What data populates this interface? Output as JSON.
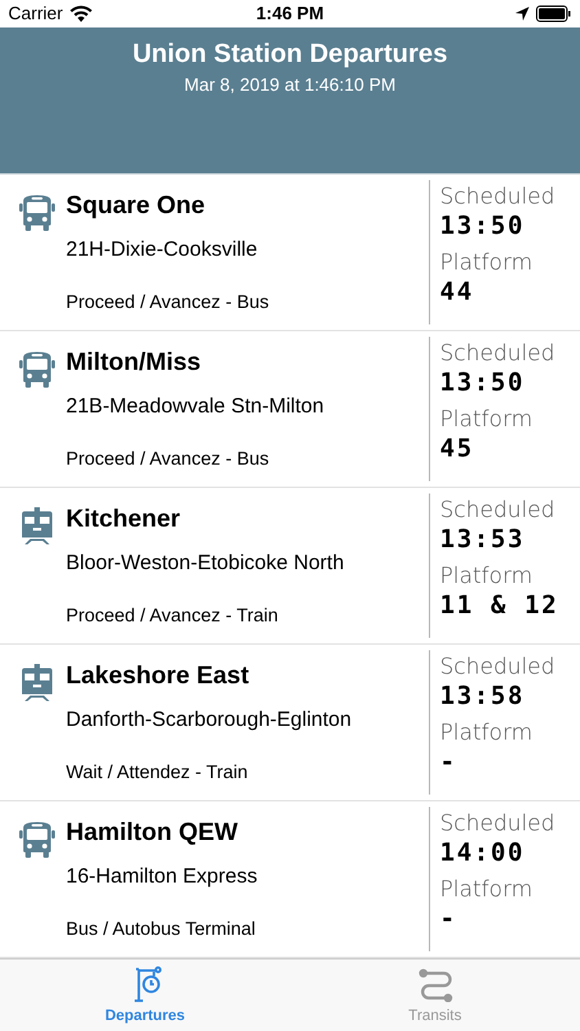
{
  "status_bar": {
    "carrier": "Carrier",
    "time": "1:46 PM"
  },
  "header": {
    "title": "Union Station Departures",
    "subtitle": "Mar 8, 2019 at 1:46:10 PM"
  },
  "departures": [
    {
      "kind": "bus",
      "destination": "Square One",
      "route": "21H-Dixie-Cooksville",
      "status": "Proceed / Avancez - Bus",
      "scheduled_label": "Scheduled",
      "scheduled": "13:50",
      "platform_label": "Platform",
      "platform": "44"
    },
    {
      "kind": "bus",
      "destination": "Milton/Miss",
      "route": "21B-Meadowvale Stn-Milton",
      "status": "Proceed / Avancez - Bus",
      "scheduled_label": "Scheduled",
      "scheduled": "13:50",
      "platform_label": "Platform",
      "platform": "45"
    },
    {
      "kind": "train",
      "destination": "Kitchener",
      "route": "Bloor-Weston-Etobicoke North",
      "status": "Proceed / Avancez - Train",
      "scheduled_label": "Scheduled",
      "scheduled": "13:53",
      "platform_label": "Platform",
      "platform": "11 & 12"
    },
    {
      "kind": "train",
      "destination": "Lakeshore East",
      "route": "Danforth-Scarborough-Eglinton",
      "status": "Wait / Attendez - Train",
      "scheduled_label": "Scheduled",
      "scheduled": "13:58",
      "platform_label": "Platform",
      "platform": "-"
    },
    {
      "kind": "bus",
      "destination": "Hamilton QEW",
      "route": "16-Hamilton Express",
      "status": "Bus / Autobus Terminal",
      "scheduled_label": "Scheduled",
      "scheduled": "14:00",
      "platform_label": "Platform",
      "platform": "-"
    }
  ],
  "tabs": [
    {
      "label": "Departures",
      "selected": true
    },
    {
      "label": "Transits",
      "selected": false
    }
  ]
}
